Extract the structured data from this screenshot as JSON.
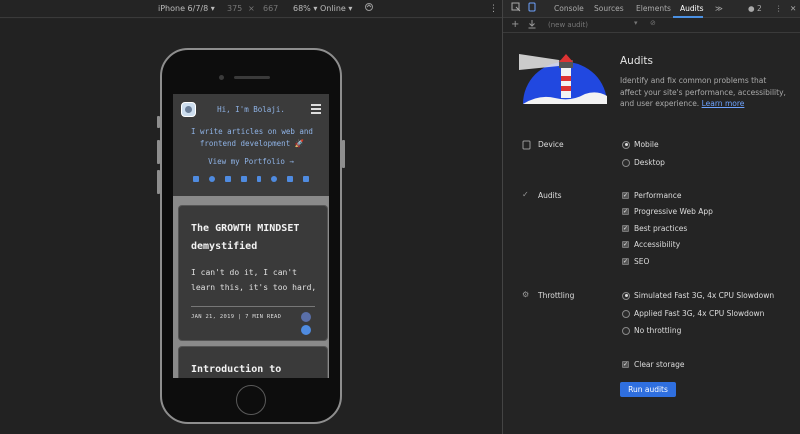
{
  "device_toolbar": {
    "device": "iPhone 6/7/8 ▾",
    "width": "375",
    "times": "×",
    "height": "667",
    "zoom": "68% ▾",
    "throttle": "Online ▾",
    "menu": "⋮"
  },
  "site": {
    "greeting": "Hi, I'm Bolaji.",
    "bio": "I write articles on web and frontend development 🚀",
    "portfolio_link": "View my Portfolio →",
    "socials": [
      "email-icon",
      "github-icon",
      "twitter-icon",
      "linkedin-icon",
      "facebook-icon",
      "instagram-icon",
      "mail-icon",
      "rss-icon"
    ],
    "cards": [
      {
        "title": "The GROWTH MINDSET demystified",
        "excerpt": "I can't do it, I can't learn this, it's too hard,",
        "meta": "JAN 21, 2019 | 7 MIN READ"
      },
      {
        "title": "Introduction to JavaScript Switch"
      }
    ]
  },
  "devtools": {
    "tabs": [
      "Console",
      "Sources",
      "Elements",
      "Audits"
    ],
    "active_tab": "Audits",
    "more_tabs": "≫",
    "warnings": "2",
    "menu": "⋮",
    "close": "✕",
    "audit_select": "(new audit)",
    "audits_title": "Audits",
    "audits_desc": "Identify and fix common problems that affect your site's performance, accessibility, and user experience.",
    "learn_more": "Learn more",
    "sections": {
      "device": {
        "label": "Device",
        "options": [
          {
            "label": "Mobile",
            "selected": true
          },
          {
            "label": "Desktop",
            "selected": false
          }
        ]
      },
      "audits": {
        "label": "Audits",
        "options": [
          {
            "label": "Performance",
            "checked": true
          },
          {
            "label": "Progressive Web App",
            "checked": true
          },
          {
            "label": "Best practices",
            "checked": true
          },
          {
            "label": "Accessibility",
            "checked": true
          },
          {
            "label": "SEO",
            "checked": true
          }
        ]
      },
      "throttling": {
        "label": "Throttling",
        "options": [
          {
            "label": "Simulated Fast 3G, 4x CPU Slowdown",
            "selected": true
          },
          {
            "label": "Applied Fast 3G, 4x CPU Slowdown",
            "selected": false
          },
          {
            "label": "No throttling",
            "selected": false
          }
        ]
      },
      "clear_storage": {
        "label": "Clear storage",
        "checked": true
      }
    },
    "run_button": "Run audits"
  },
  "colors": {
    "accent": "#2f6fdf",
    "link": "#6ea3ff",
    "site_text": "#8fb3e6"
  }
}
